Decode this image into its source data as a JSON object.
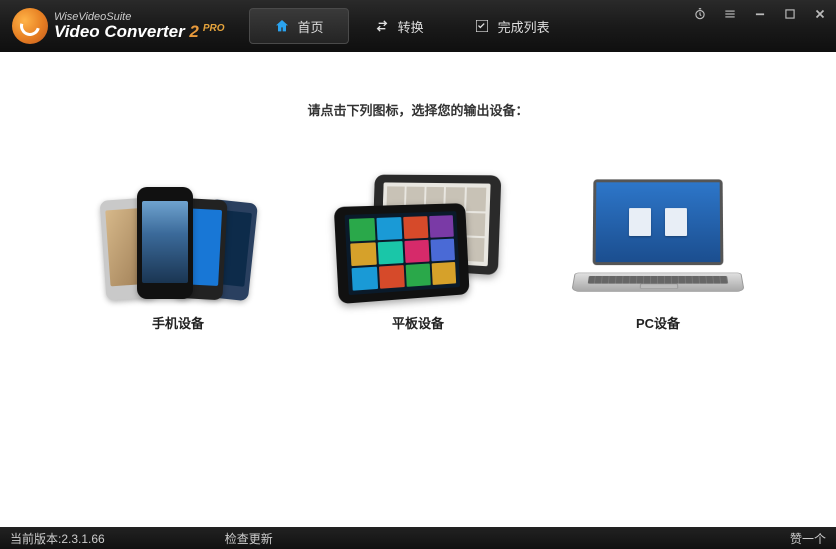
{
  "app": {
    "suite_name": "WiseVideoSuite",
    "product_name_prefix": "Video Converter ",
    "product_version_num": "2",
    "pro_badge": "PRO"
  },
  "tabs": {
    "home": "首页",
    "convert": "转换",
    "completed": "完成列表"
  },
  "main": {
    "prompt": "请点击下列图标，选择您的输出设备：",
    "devices": {
      "phone": "手机设备",
      "tablet": "平板设备",
      "pc": "PC设备"
    }
  },
  "statusbar": {
    "version_label": "当前版本:",
    "version_value": "2.3.1.66",
    "check_updates": "检查更新",
    "like": "赞一个"
  }
}
